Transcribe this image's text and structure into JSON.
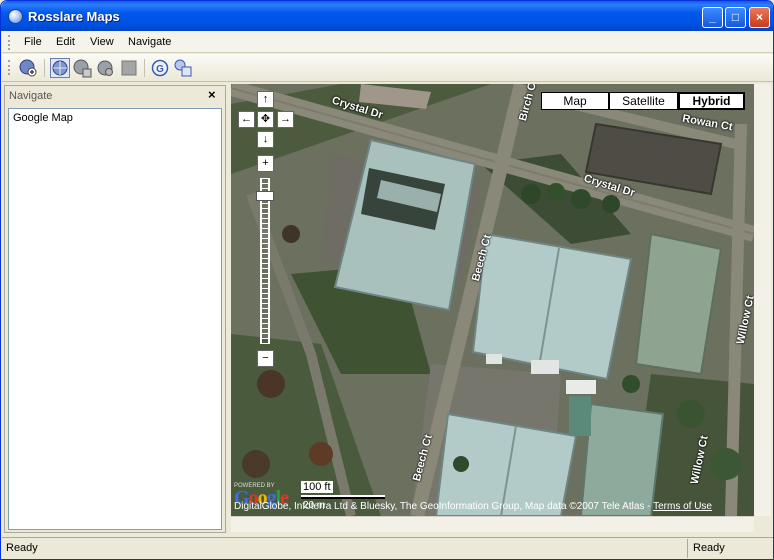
{
  "window": {
    "title": "Rosslare Maps"
  },
  "menu": {
    "items": [
      "File",
      "Edit",
      "View",
      "Navigate"
    ]
  },
  "toolbar": {
    "icons": [
      "add-map-icon",
      "globe-icon",
      "globe-save-icon",
      "globe-settings-icon",
      "stop-icon",
      "google-icon",
      "layers-icon"
    ]
  },
  "panel": {
    "title": "Navigate",
    "close_glyph": "×",
    "tree_item": "Google Map"
  },
  "map": {
    "types": [
      "Map",
      "Satellite",
      "Hybrid"
    ],
    "active_type": "Hybrid",
    "roads": [
      "Crystal Dr",
      "Birch Ct",
      "Rowan Ct",
      "Crystal Dr",
      "Beech Ct",
      "Willow Ct",
      "Beech Ct",
      "Willow Ct"
    ],
    "controls": {
      "up": "↑",
      "left": "←",
      "center": "✥",
      "right": "→",
      "down": "↓",
      "zoom_in": "+",
      "zoom_out": "−"
    },
    "powered_by": "POWERED BY",
    "logo": "Google",
    "scale_top": "100 ft",
    "scale_bottom": "20 m",
    "copyright": "DigitalGlobe, Infoterra Ltd & Bluesky, The GeoInformation Group, Map data ©2007 Tele Atlas - ",
    "terms": "Terms of Use"
  },
  "status": {
    "left": "Ready",
    "right": "Ready"
  },
  "colors": {
    "title_bar": "#0058EE",
    "map_bg": "#5d6550"
  }
}
